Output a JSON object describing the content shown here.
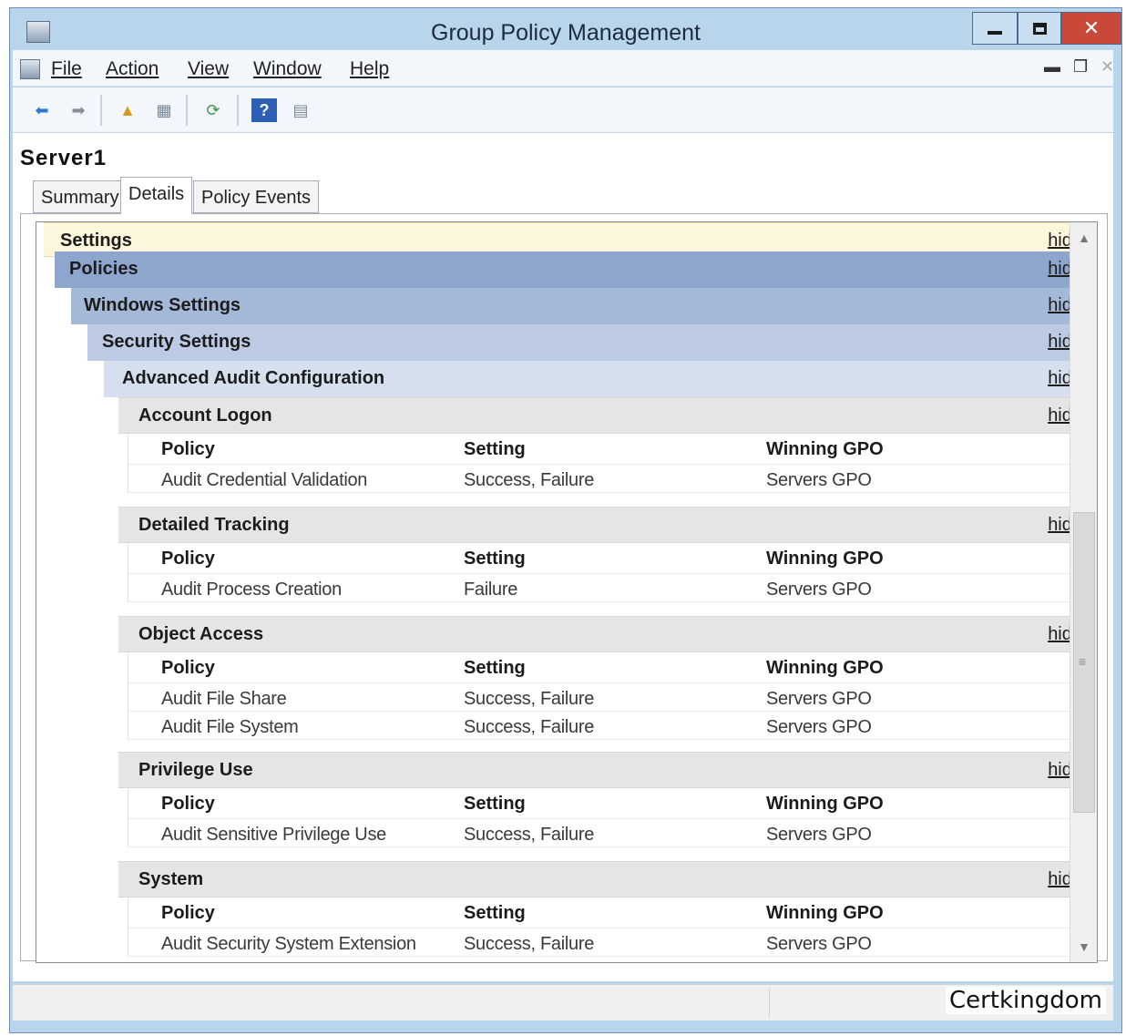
{
  "window": {
    "title": "Group Policy Management"
  },
  "menu": {
    "file": "File",
    "action": "Action",
    "view": "View",
    "window": "Window",
    "help": "Help"
  },
  "toolbar": {
    "icons": [
      "back-arrow-icon",
      "forward-arrow-icon",
      "up-folder-icon",
      "show-hide-console-tree-icon",
      "refresh-icon",
      "help-icon",
      "show-action-pane-icon"
    ]
  },
  "server": "Server1",
  "tabs": [
    {
      "label": "Summary",
      "active": false
    },
    {
      "label": "Details",
      "active": true
    },
    {
      "label": "Policy Events",
      "active": false
    }
  ],
  "report": {
    "hide_label": "hide",
    "headers": [
      "Settings",
      "Policies",
      "Windows Settings",
      "Security Settings",
      "Advanced Audit Configuration"
    ],
    "column_headers": {
      "policy": "Policy",
      "setting": "Setting",
      "winning_gpo": "Winning GPO"
    },
    "categories": [
      {
        "name": "Account Logon",
        "rows": [
          {
            "policy": "Audit Credential Validation",
            "setting": "Success, Failure",
            "gpo": "Servers GPO"
          }
        ]
      },
      {
        "name": "Detailed Tracking",
        "rows": [
          {
            "policy": "Audit Process Creation",
            "setting": "Failure",
            "gpo": "Servers GPO"
          }
        ]
      },
      {
        "name": "Object Access",
        "rows": [
          {
            "policy": "Audit File Share",
            "setting": "Success, Failure",
            "gpo": "Servers GPO"
          },
          {
            "policy": "Audit File System",
            "setting": "Success, Failure",
            "gpo": "Servers GPO"
          }
        ]
      },
      {
        "name": "Privilege Use",
        "rows": [
          {
            "policy": "Audit Sensitive Privilege Use",
            "setting": "Success, Failure",
            "gpo": "Servers GPO"
          }
        ]
      },
      {
        "name": "System",
        "rows": [
          {
            "policy": "Audit Security System Extension",
            "setting": "Success, Failure",
            "gpo": "Servers GPO"
          }
        ]
      }
    ]
  },
  "watermark": "Certkingdom",
  "colors": {
    "titlebar": "#b9d5ec",
    "close_button": "#c8483a",
    "settings_header": "#fcf6dc",
    "policies_header": "#8ea6ce",
    "windows_settings_header": "#a4b8d8",
    "security_settings_header": "#bccbe3",
    "advanced_audit_header": "#d5dfee",
    "category_header": "#e5e5e5"
  }
}
